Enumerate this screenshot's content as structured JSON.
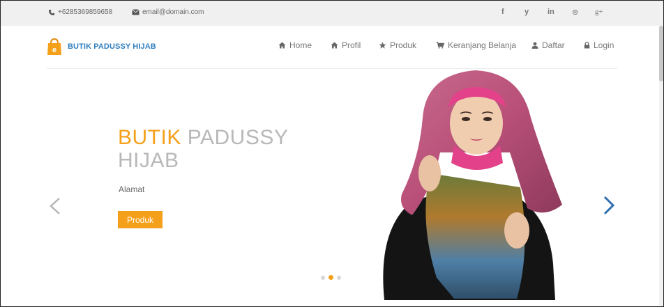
{
  "topbar": {
    "phone": "+6285369859658",
    "email": "email@domain.com",
    "social": [
      {
        "label": "f",
        "icon": "facebook-icon"
      },
      {
        "label": "y",
        "icon": "twitter-icon"
      },
      {
        "label": "in",
        "icon": "linkedin-icon"
      },
      {
        "label": "⊛",
        "icon": "dribbble-icon"
      },
      {
        "label": "g+",
        "icon": "google-plus-icon"
      }
    ]
  },
  "brand": {
    "name": "BUTIK PADUSSY HIJAB",
    "logo_letter": "e"
  },
  "nav": [
    {
      "label": "Home",
      "icon": "home-icon"
    },
    {
      "label": "Profil",
      "icon": "home-icon"
    },
    {
      "label": "Produk",
      "icon": "star-icon"
    },
    {
      "label": "Keranjang Belanja",
      "icon": "cart-icon"
    },
    {
      "label": "Daftar",
      "icon": "user-icon"
    },
    {
      "label": "Login",
      "icon": "lock-icon"
    }
  ],
  "hero": {
    "title_accent": "BUTIK",
    "title_rest": "PADUSSY",
    "title_line2": "HIJAB",
    "subtitle": "Alamat",
    "button_label": "Produk",
    "active_slide": 2,
    "slide_count": 3
  },
  "colors": {
    "accent": "#f5a01a",
    "brand": "#2f7fc0",
    "arrow_left": "#b5b5b5",
    "arrow_right": "#2f6fb0"
  }
}
